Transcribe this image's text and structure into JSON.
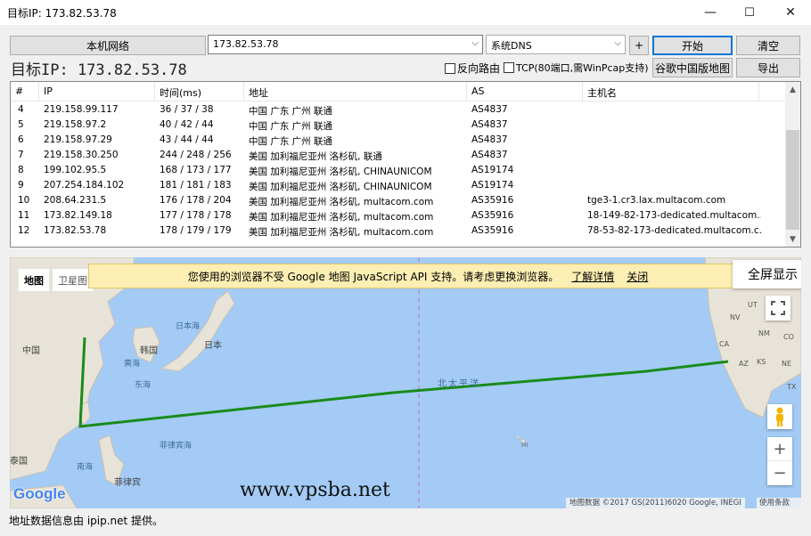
{
  "window": {
    "title": "目标IP: 173.82.53.78",
    "minimize": "—",
    "maximize": "☐",
    "close": "✕"
  },
  "toolbar": {
    "local_net_label": "本机网络",
    "target_value": "173.82.53.78",
    "dns_value": "系统DNS",
    "plus_label": "+",
    "start_label": "开始",
    "clear_label": "清空",
    "google_cn_map_label": "谷歌中国版地图",
    "export_label": "导出",
    "big_ip": "目标IP: 173.82.53.78",
    "reverse_label": "反向路由",
    "tcp_label": "TCP(80端口,需WinPcap支持)"
  },
  "table": {
    "headers": [
      "#",
      "IP",
      "时间(ms)",
      "地址",
      "AS",
      "主机名"
    ],
    "rows": [
      [
        "4",
        "219.158.99.117",
        "36 / 37 / 38",
        "中国 广东 广州 联通",
        "AS4837",
        ""
      ],
      [
        "5",
        "219.158.97.2",
        "40 / 42 / 44",
        "中国 广东 广州 联通",
        "AS4837",
        ""
      ],
      [
        "6",
        "219.158.97.29",
        "43 / 44 / 44",
        "中国 广东 广州 联通",
        "AS4837",
        ""
      ],
      [
        "7",
        "219.158.30.250",
        "244 / 248 / 256",
        "美国 加利福尼亚州 洛杉矶, 联通",
        "AS4837",
        ""
      ],
      [
        "8",
        "199.102.95.5",
        "168 / 173 / 177",
        "美国 加利福尼亚州 洛杉矶, CHINAUNICOM",
        "AS19174",
        ""
      ],
      [
        "9",
        "207.254.184.102",
        "181 / 181 / 183",
        "美国 加利福尼亚州 洛杉矶, CHINAUNICOM",
        "AS19174",
        ""
      ],
      [
        "10",
        "208.64.231.5",
        "176 / 178 / 204",
        "美国 加利福尼亚州 洛杉矶, multacom.com",
        "AS35916",
        "tge3-1.cr3.lax.multacom.com"
      ],
      [
        "11",
        "173.82.149.18",
        "177 / 178 / 178",
        "美国 加利福尼亚州 洛杉矶, multacom.com",
        "AS35916",
        "18-149-82-173-dedicated.multacom...."
      ],
      [
        "12",
        "173.82.53.78",
        "178 / 179 / 179",
        "美国 加利福尼亚州 洛杉矶, multacom.com",
        "AS35916",
        "78-53-82-173-dedicated.multacom.c..."
      ]
    ],
    "scroll_up": "▲",
    "scroll_down": "▼"
  },
  "map": {
    "tab_map": "地图",
    "tab_satellite": "卫星图",
    "banner_text": "您使用的浏览器不受 Google 地图 JavaScript API 支持。请考虑更换浏览器。",
    "banner_link": "了解详情",
    "banner_close": "关闭",
    "fullscreen_label": "全屏显示",
    "zoom_in": "+",
    "zoom_out": "−",
    "labels": {
      "china": "中国",
      "korea": "韩国",
      "sea_of_japan": "日本海",
      "japan": "日本",
      "yellow_sea": "黄海",
      "east_sea": "东海",
      "north_pacific": "北太平洋",
      "philippine_sea": "菲律宾海",
      "south_sea": "南海",
      "thailand": "泰国",
      "philippines": "菲律宾",
      "hawaii": "HI",
      "ca": "CA",
      "az": "AZ",
      "nv": "NV",
      "ut": "UT",
      "co": "CO",
      "nm": "NM",
      "tx": "TX",
      "ks": "KS",
      "ne": "NE"
    },
    "google_logo": "Google",
    "watermark": "www.vpsba.net",
    "attribution": "地图数据 ©2017 GS(2011)6020 Google, INEGI",
    "terms": "使用条款",
    "route_color": "#1a8a1a",
    "water_color": "#a3cbf5",
    "land_color": "#e8e3d8"
  },
  "status": {
    "text": "地址数据信息由 ipip.net 提供。"
  }
}
